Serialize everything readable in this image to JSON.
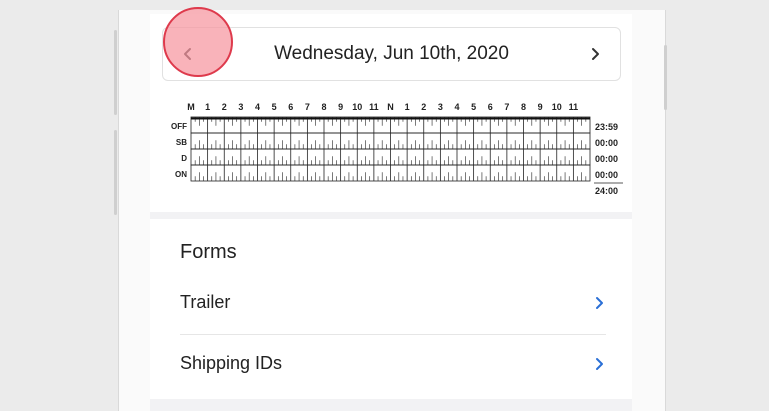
{
  "date_nav": {
    "title": "Wednesday, Jun 10th, 2020",
    "prev_icon": "chevron-left-icon",
    "next_icon": "chevron-right-icon"
  },
  "log_grid": {
    "hour_labels": [
      "M",
      "1",
      "2",
      "3",
      "4",
      "5",
      "6",
      "7",
      "8",
      "9",
      "10",
      "11",
      "N",
      "1",
      "2",
      "3",
      "4",
      "5",
      "6",
      "7",
      "8",
      "9",
      "10",
      "11"
    ],
    "rows": [
      {
        "label": "OFF",
        "total": "23:59"
      },
      {
        "label": "SB",
        "total": "00:00"
      },
      {
        "label": "D",
        "total": "00:00"
      },
      {
        "label": "ON",
        "total": "00:00"
      }
    ],
    "grand_total": "24:00"
  },
  "forms": {
    "title": "Forms",
    "items": [
      {
        "label": "Trailer",
        "icon": "chevron-right-icon"
      },
      {
        "label": "Shipping IDs",
        "icon": "chevron-right-icon"
      }
    ]
  },
  "colors": {
    "accent": "#2a6fd6",
    "tap_highlight": "#f696a0"
  }
}
